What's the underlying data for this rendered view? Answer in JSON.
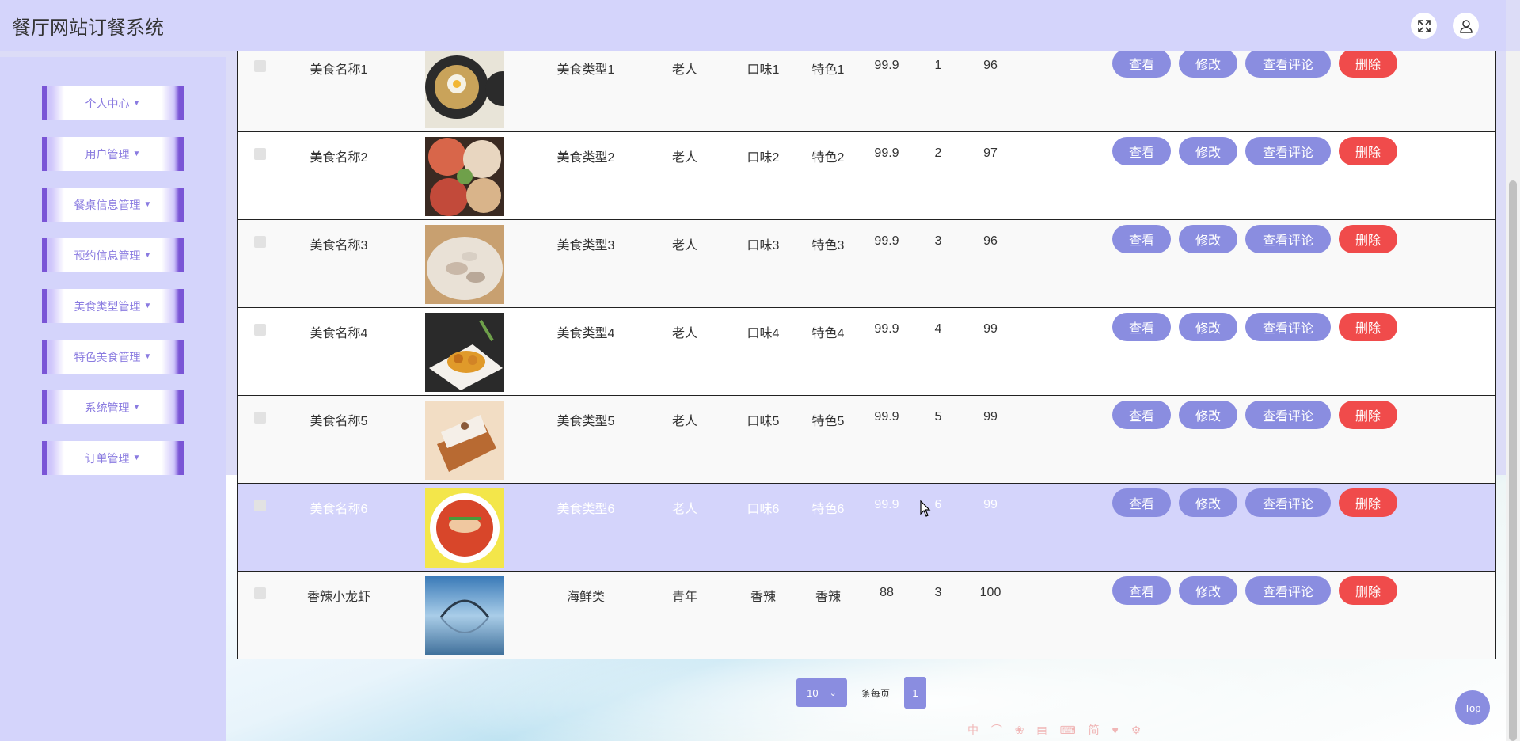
{
  "header": {
    "title": "餐厅网站订餐系统",
    "fullscreen_icon": "expand-icon",
    "user_icon": "user-icon"
  },
  "sidebar": {
    "items": [
      {
        "label": "个人中心"
      },
      {
        "label": "用户管理"
      },
      {
        "label": "餐桌信息管理"
      },
      {
        "label": "预约信息管理"
      },
      {
        "label": "美食类型管理"
      },
      {
        "label": "特色美食管理"
      },
      {
        "label": "系统管理"
      },
      {
        "label": "订单管理"
      }
    ]
  },
  "table": {
    "rows": [
      {
        "name": "美食名称1",
        "type": "美食类型1",
        "audience": "老人",
        "flavor": "口味1",
        "feature": "特色1",
        "price": "99.9",
        "col7": "1",
        "col8": "96",
        "image": "egg-dish"
      },
      {
        "name": "美食名称2",
        "type": "美食类型2",
        "audience": "老人",
        "flavor": "口味2",
        "feature": "特色2",
        "price": "99.9",
        "col7": "2",
        "col8": "97",
        "image": "platter"
      },
      {
        "name": "美食名称3",
        "type": "美食类型3",
        "audience": "老人",
        "flavor": "口味3",
        "feature": "特色3",
        "price": "99.9",
        "col7": "3",
        "col8": "96",
        "image": "seafood-pot"
      },
      {
        "name": "美食名称4",
        "type": "美食类型4",
        "audience": "老人",
        "flavor": "口味4",
        "feature": "特色4",
        "price": "99.9",
        "col7": "4",
        "col8": "99",
        "image": "fried-dish"
      },
      {
        "name": "美食名称5",
        "type": "美食类型5",
        "audience": "老人",
        "flavor": "口味5",
        "feature": "特色5",
        "price": "99.9",
        "col7": "5",
        "col8": "99",
        "image": "cake"
      },
      {
        "name": "美食名称6",
        "type": "美食类型6",
        "audience": "老人",
        "flavor": "口味6",
        "feature": "特色6",
        "price": "99.9",
        "col7": "6",
        "col8": "99",
        "image": "fish-bowl"
      },
      {
        "name": "香辣小龙虾",
        "type": "海鲜类",
        "audience": "青年",
        "flavor": "香辣",
        "feature": "香辣",
        "price": "88",
        "col7": "3",
        "col8": "100",
        "image": "bridge-landscape"
      }
    ],
    "actions": {
      "view": "查看",
      "edit": "修改",
      "comments": "查看评论",
      "delete": "删除"
    }
  },
  "pager": {
    "page_size": "10",
    "per_page_label": "条每页",
    "current_page": "1"
  },
  "back_to_top": "Top",
  "ime_bar": "中 ⌒ ❀ ▤ ⌨ 简 ♥ ⚙",
  "colors": {
    "accent": "#8a8de0",
    "danger": "#f04b4b",
    "header": "#d4d4fb",
    "highlight_row": "#d4d4fb"
  }
}
